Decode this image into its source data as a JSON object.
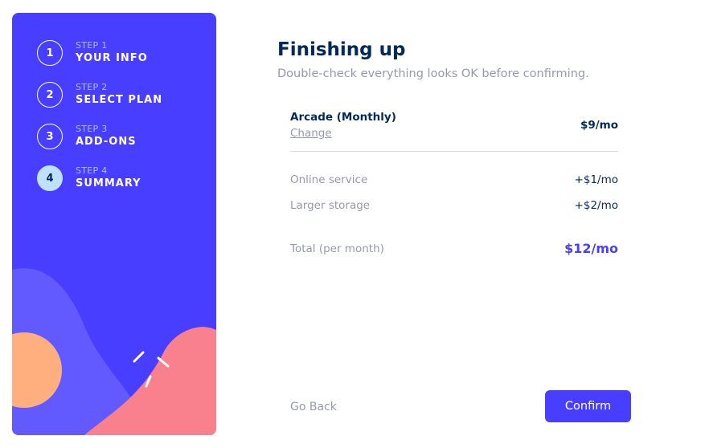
{
  "steps": [
    {
      "number": "1",
      "caption": "STEP 1",
      "title": "YOUR INFO",
      "active": false
    },
    {
      "number": "2",
      "caption": "STEP 2",
      "title": "SELECT PLAN",
      "active": false
    },
    {
      "number": "3",
      "caption": "STEP 3",
      "title": "ADD-ONS",
      "active": false
    },
    {
      "number": "4",
      "caption": "STEP 4",
      "title": "SUMMARY",
      "active": true
    }
  ],
  "main": {
    "title": "Finishing up",
    "subtitle": "Double-check everything looks OK before confirming."
  },
  "summary": {
    "plan_name": "Arcade (Monthly)",
    "change_label": "Change",
    "plan_price": "$9/mo",
    "addons": [
      {
        "name": "Online service",
        "price": "+$1/mo"
      },
      {
        "name": "Larger storage",
        "price": "+$2/mo"
      }
    ],
    "total_label": "Total (per month)",
    "total_price": "$12/mo"
  },
  "actions": {
    "back_label": "Go Back",
    "confirm_label": "Confirm"
  },
  "colors": {
    "sidebar": "#483eff",
    "accent": "#483eff",
    "active_step": "#bee2fd",
    "heading": "#022959",
    "muted": "#9699aa"
  }
}
